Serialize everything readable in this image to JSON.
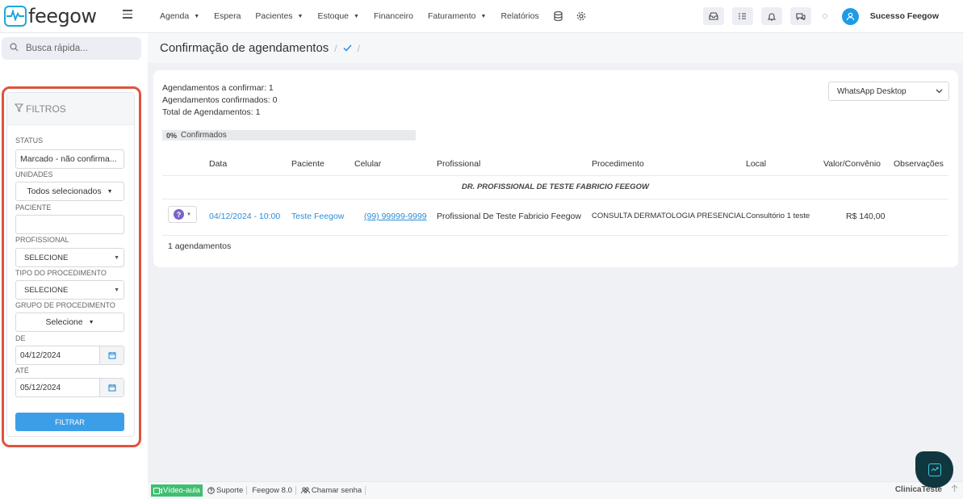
{
  "app": {
    "logo_text": "feegow"
  },
  "nav": {
    "items": [
      {
        "label": "Agenda",
        "dropdown": true
      },
      {
        "label": "Espera",
        "dropdown": false
      },
      {
        "label": "Pacientes",
        "dropdown": true
      },
      {
        "label": "Estoque",
        "dropdown": true
      },
      {
        "label": "Financeiro",
        "dropdown": false
      },
      {
        "label": "Faturamento",
        "dropdown": true
      },
      {
        "label": "Relatórios",
        "dropdown": false
      }
    ],
    "caret": "▼"
  },
  "user": {
    "name": "Sucesso Feegow"
  },
  "search": {
    "placeholder": "Busca rápida..."
  },
  "filters": {
    "title": "FILTROS",
    "status_label": "STATUS",
    "status_value": "Marcado - não confirma...",
    "unidades_label": "UNIDADES",
    "unidades_value": "Todos selecionados",
    "paciente_label": "PACIENTE",
    "paciente_value": "",
    "profissional_label": "PROFISSIONAL",
    "profissional_value": "SELECIONE",
    "tipo_label": "TIPO DO PROCEDIMENTO",
    "tipo_value": "SELECIONE",
    "grupo_label": "GRUPO DE PROCEDIMENTO",
    "grupo_value": "Selecione",
    "de_label": "DE",
    "de_value": "04/12/2024",
    "ate_label": "ATÉ",
    "ate_value": "05/12/2024",
    "filtrar_label": "FILTRAR"
  },
  "page": {
    "title": "Confirmação de agendamentos",
    "sep": "/"
  },
  "stats": {
    "a_confirmar": "Agendamentos a confirmar: 1",
    "confirmados": "Agendamentos confirmados: 0",
    "total": "Total de Agendamentos: 1"
  },
  "channel": {
    "value": "WhatsApp Desktop"
  },
  "progress": {
    "percent_label": "0%",
    "label": "Confirmados",
    "value": 0
  },
  "table": {
    "headers": [
      "Data",
      "Paciente",
      "Celular",
      "Profissional",
      "Procedimento",
      "Local",
      "Valor/Convênio",
      "Observações"
    ],
    "group": "DR. PROFISSIONAL DE TESTE FABRICIO FEEGOW",
    "row": {
      "status": "?",
      "data": "04/12/2024 - 10:00",
      "paciente": "Teste Feegow",
      "celular": "(99) 99999-9999",
      "profissional": "Profissional De Teste Fabricio Feegow",
      "procedimento": "CONSULTA DERMATOLOGIA PRESENCIAL",
      "local": "Consultório 1 teste",
      "valor": "R$ 140,00"
    },
    "count": "1 agendamentos"
  },
  "footer": {
    "video": "Vídeo-aula",
    "suporte": "Suporte",
    "version": "Feegow 8.0",
    "chamar": "Chamar senha",
    "clinic": "ClinicaTeste"
  },
  "colors": {
    "accent": "#3d9ee8",
    "highlight": "#e0533f",
    "video": "#3fbf6f"
  }
}
